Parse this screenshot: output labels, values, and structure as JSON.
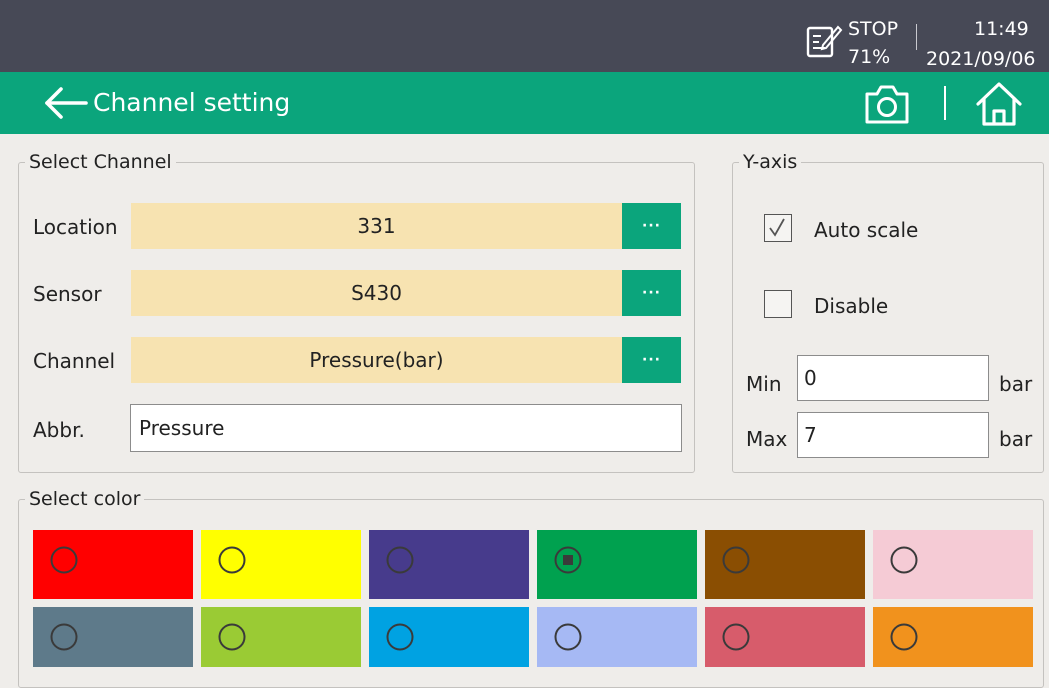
{
  "status_bar": {
    "state": "STOP",
    "battery": "71%",
    "time": "11:49",
    "date": "2021/09/06"
  },
  "header": {
    "title": "Channel setting",
    "icons": [
      "back-arrow-icon",
      "camera-icon",
      "home-icon"
    ]
  },
  "select_channel": {
    "legend": "Select Channel",
    "location_label": "Location",
    "location_value": "331",
    "sensor_label": "Sensor",
    "sensor_value": "S430",
    "channel_label": "Channel",
    "channel_value": "Pressure(bar)",
    "more_label": "···",
    "abbr_label": "Abbr.",
    "abbr_value": "Pressure"
  },
  "y_axis": {
    "legend": "Y-axis",
    "auto_scale_label": "Auto scale",
    "auto_scale_checked": true,
    "disable_label": "Disable",
    "disable_checked": false,
    "min_label": "Min",
    "min_value": "0",
    "max_label": "Max",
    "max_value": "7",
    "unit": "bar"
  },
  "select_color": {
    "legend": "Select color",
    "selected_index": 3,
    "colors": [
      "#ff0000",
      "#ffff00",
      "#473b8c",
      "#00a14f",
      "#8a4e02",
      "#f5cbd5",
      "#5e7a8a",
      "#9acb34",
      "#00a2e2",
      "#a6b9f4",
      "#d75c6b",
      "#f1921d"
    ]
  }
}
